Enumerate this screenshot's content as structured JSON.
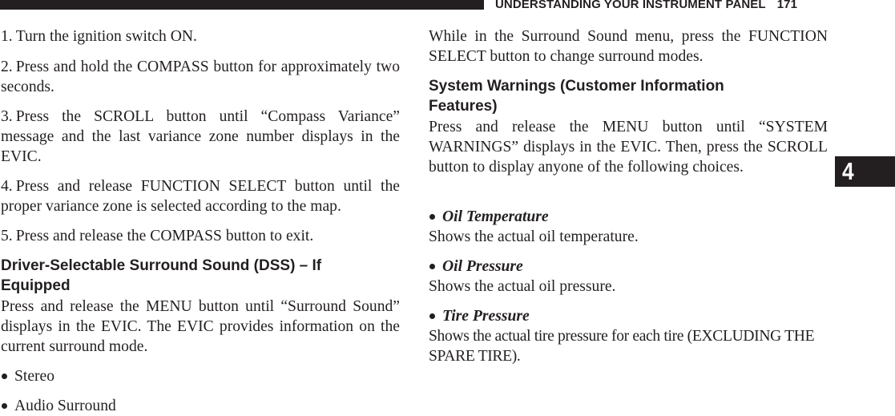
{
  "header": {
    "section_title": "UNDERSTANDING YOUR INSTRUMENT PANEL",
    "page_number": "171"
  },
  "chapter_tab": {
    "label": "4"
  },
  "left_column": {
    "steps": [
      {
        "num": "1.",
        "text": "Turn the ignition switch ON."
      },
      {
        "num": "2.",
        "text": "Press and hold the COMPASS button for approximately two seconds."
      },
      {
        "num": "3.",
        "text": "Press the SCROLL button until “Compass Variance” message and the last variance zone number displays in the EVIC."
      },
      {
        "num": "4.",
        "text": "Press and release FUNCTION SELECT button until the proper variance zone is selected according to the map."
      },
      {
        "num": "5.",
        "text": "Press and release the COMPASS button to exit."
      }
    ],
    "dss_heading": "Driver-Selectable Surround Sound (DSS) – If Equipped",
    "dss_body": "Press and release the MENU button until “Surround Sound” displays in the EVIC. The EVIC provides information on the current surround mode.",
    "dss_modes": [
      "Stereo",
      "Audio Surround"
    ]
  },
  "right_column": {
    "intro": "While in the Surround Sound menu, press the FUNCTION SELECT button to change surround modes.",
    "warnings_heading": "System Warnings (Customer Information Features)",
    "warnings_body": "Press and release the MENU button until “SYSTEM WARNINGS” displays in the EVIC. Then, press the SCROLL button to display anyone of the following choices.",
    "choices": [
      {
        "title": "Oil Temperature",
        "desc": "Shows the actual oil temperature."
      },
      {
        "title": "Oil Pressure",
        "desc": "Shows the actual oil pressure."
      },
      {
        "title": "Tire Pressure",
        "desc": "Shows the actual tire pressure for each tire (EXCLUDING THE SPARE TIRE)."
      }
    ]
  }
}
